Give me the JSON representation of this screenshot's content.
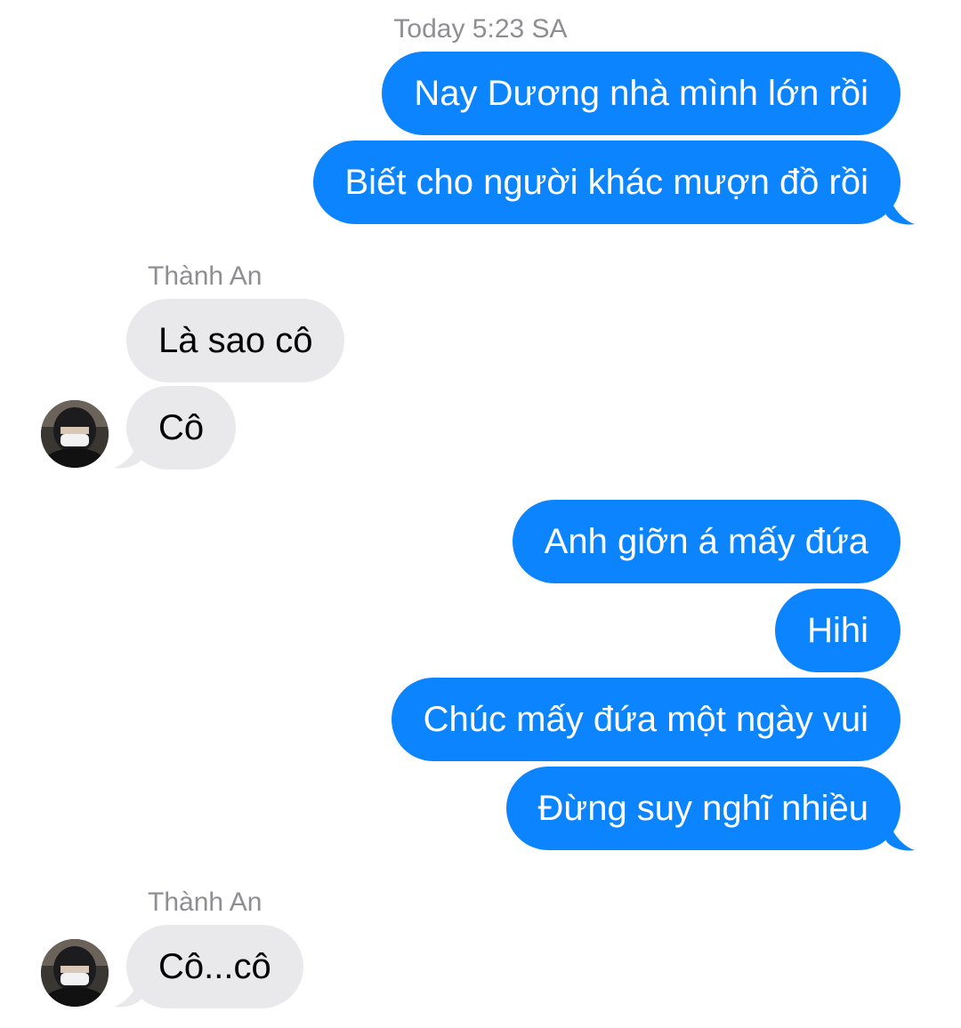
{
  "thread": {
    "timestamp": "Today 5:23 SA",
    "contact_name": "Thành An"
  },
  "messages": [
    {
      "direction": "outgoing",
      "text": "Nay Dương nhà mình lớn rồi"
    },
    {
      "direction": "outgoing",
      "text": "Biết cho người khác mượn đồ rồi"
    },
    {
      "direction": "incoming",
      "sender": "Thành An",
      "text": "Là sao cô"
    },
    {
      "direction": "incoming",
      "text": "Cô"
    },
    {
      "direction": "outgoing",
      "text": "Anh giỡn á mấy đứa"
    },
    {
      "direction": "outgoing",
      "text": "Hihi"
    },
    {
      "direction": "outgoing",
      "text": "Chúc mấy đứa một ngày vui"
    },
    {
      "direction": "outgoing",
      "text": "Đừng suy nghĩ nhiều"
    },
    {
      "direction": "incoming",
      "sender": "Thành An",
      "text": "Cô...cô"
    }
  ],
  "colors": {
    "outgoing_bubble": "#0b84fe",
    "incoming_bubble": "#e9e9eb",
    "meta_text": "#8e8e93"
  },
  "icons": {
    "avatar": "contact-avatar-photo"
  }
}
